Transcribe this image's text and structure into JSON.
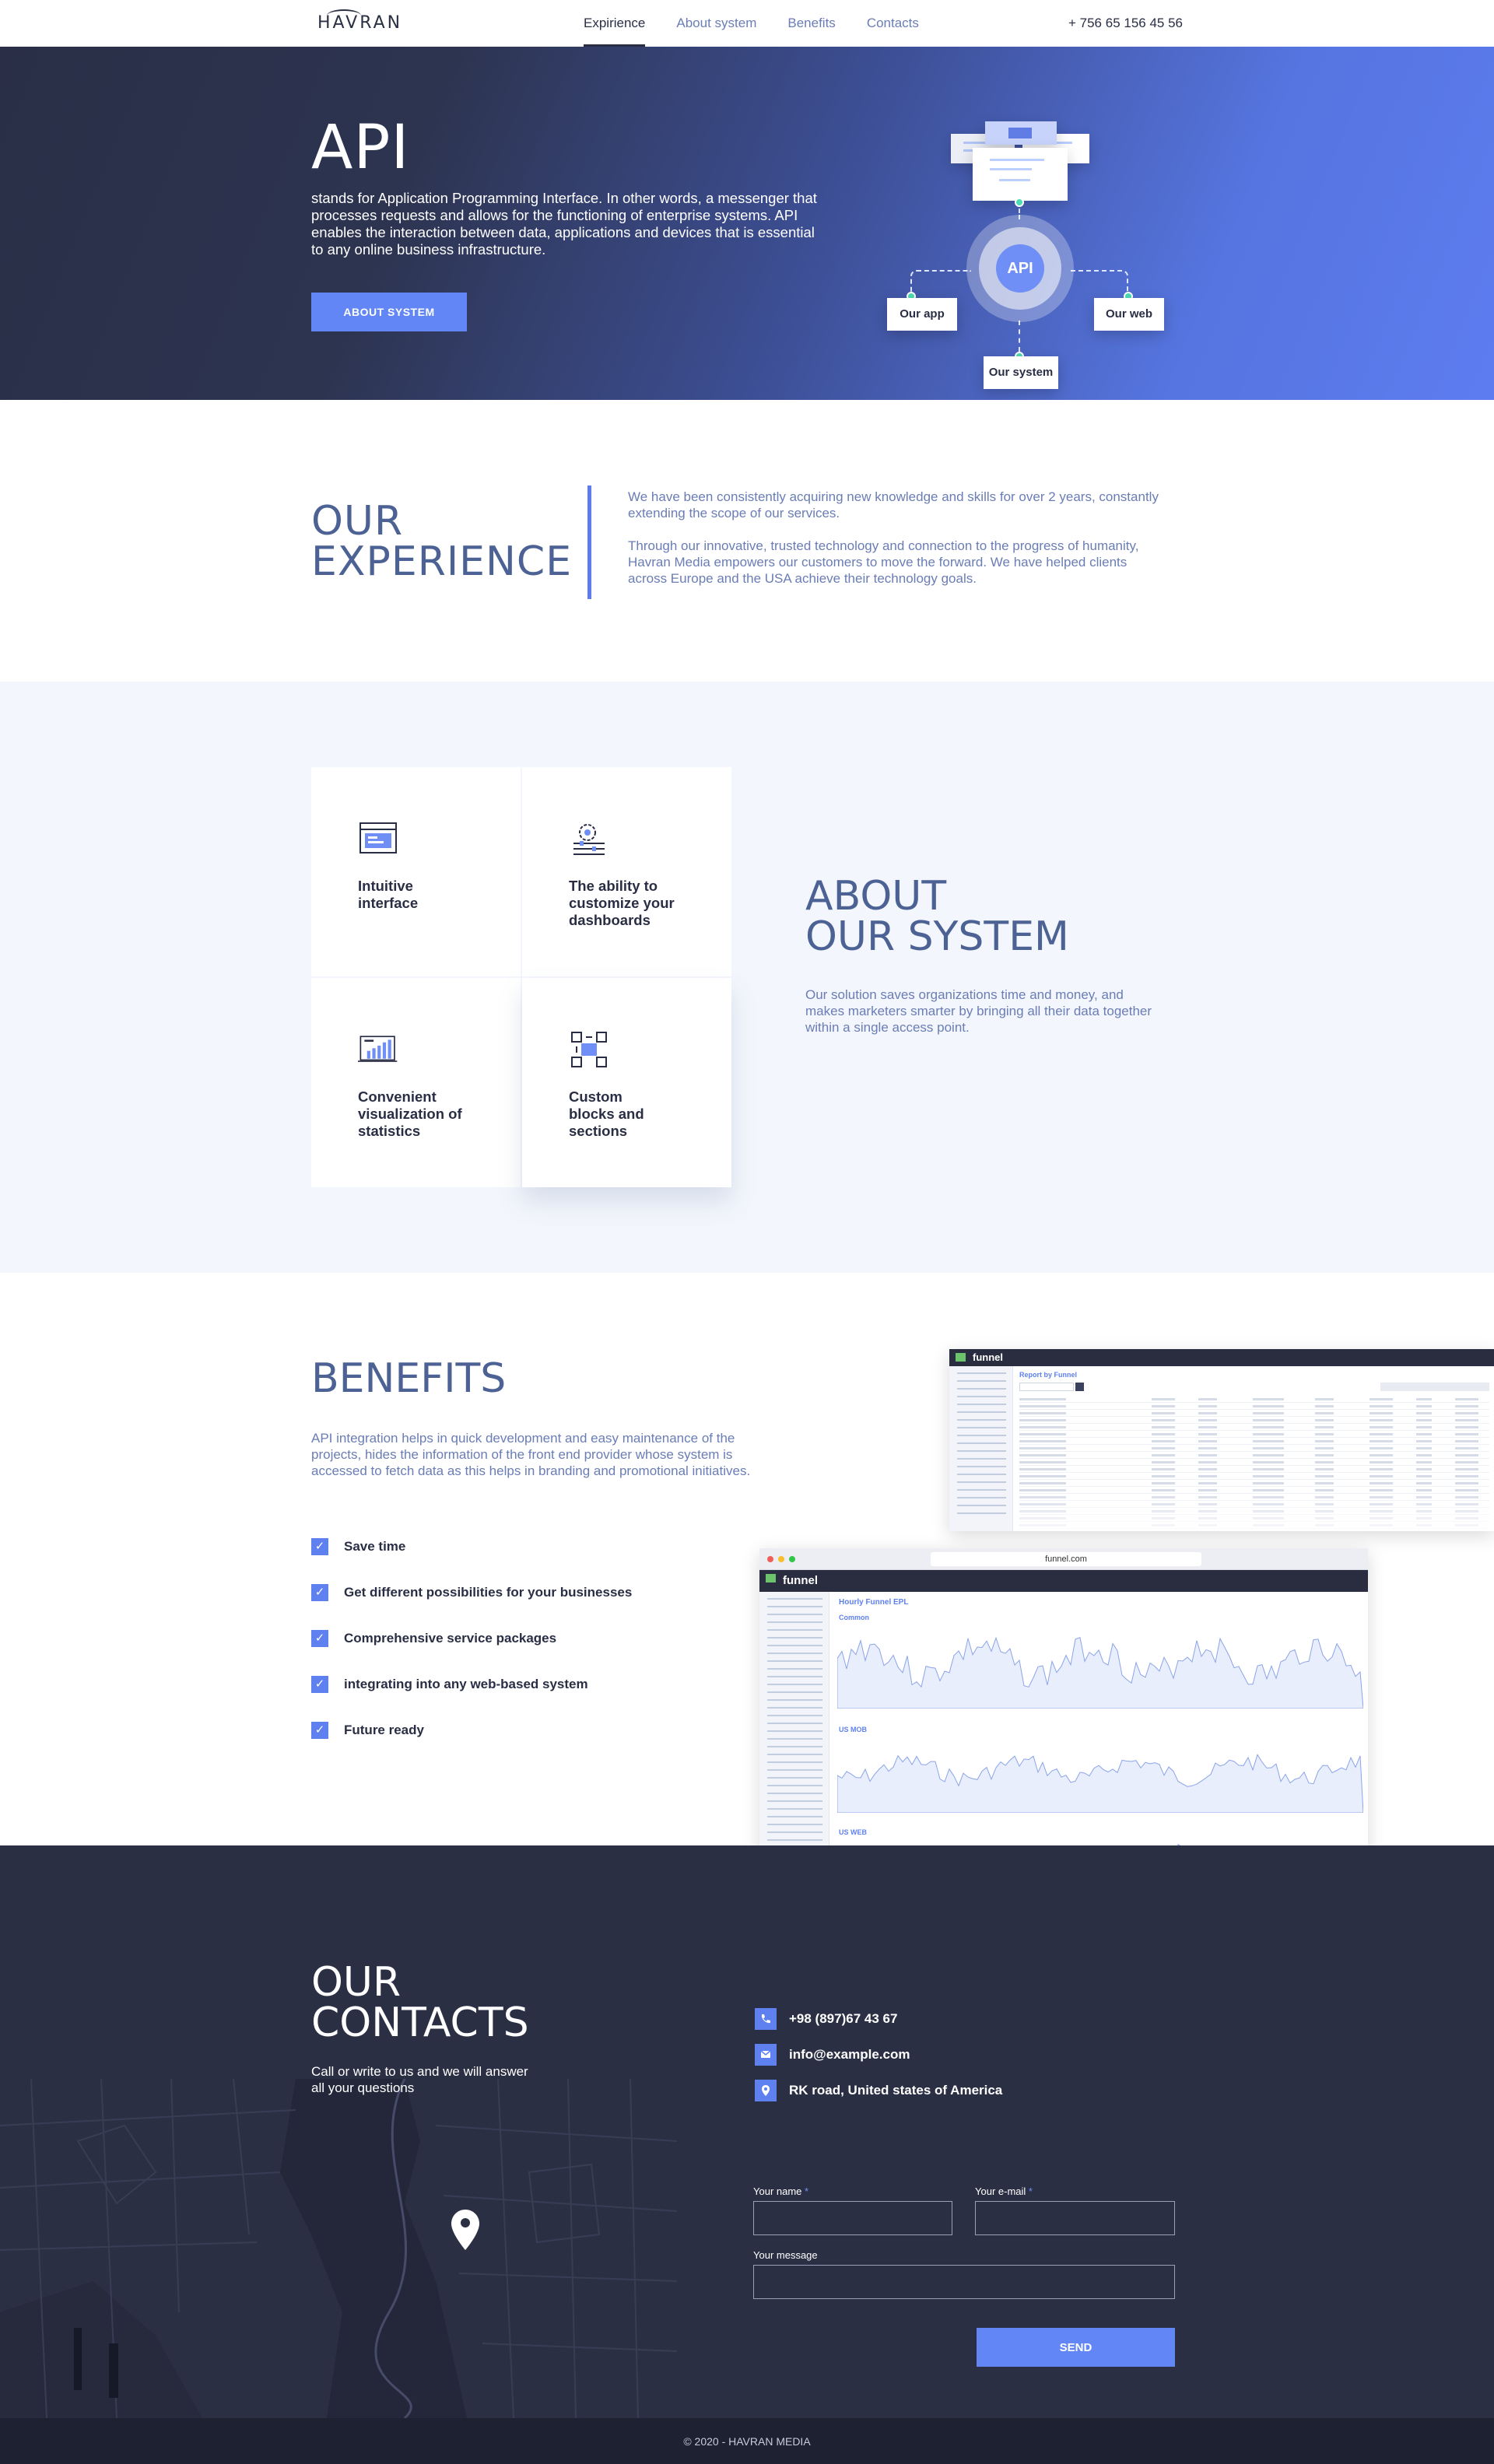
{
  "header": {
    "logo": "HAVRAN",
    "nav": [
      {
        "label": "Expirience",
        "active": true
      },
      {
        "label": "About system",
        "active": false
      },
      {
        "label": "Benefits",
        "active": false
      },
      {
        "label": "Contacts",
        "active": false
      }
    ],
    "phone": "+ 756 65 156 45 56"
  },
  "hero": {
    "title": "API",
    "description": "stands for Application Programming Interface. In other words, a messenger that processes requests and allows for the functioning of enterprise systems. API enables the interaction between data, applications and devices that is essential to any online business infrastructure.",
    "button": "ABOUT SYSTEM",
    "diagram": {
      "center": "API",
      "left": "Our app",
      "right": "Our web",
      "bottom": "Our system"
    }
  },
  "experience": {
    "title_line1": "OUR",
    "title_line2": "EXPERIENCE",
    "paragraph1": "We have been consistently acquiring new knowledge and skills for over 2 years, constantly extending the scope of our services.",
    "paragraph2": "Through our innovative, trusted technology and connection to the progress of humanity, Havran Media empowers our customers to move the forward. We have helped clients across Europe and the USA achieve their technology goals."
  },
  "about": {
    "features": [
      {
        "title": "Intuitive interface",
        "icon": "browser-window-icon"
      },
      {
        "title": "The ability to customize your dashboards",
        "icon": "gear-sliders-icon"
      },
      {
        "title": "Convenient visualization of statistics",
        "icon": "bar-chart-icon"
      },
      {
        "title": "Custom blocks and sections",
        "icon": "blocks-grid-icon"
      }
    ],
    "title_line1": "ABOUT",
    "title_line2": "OUR SYSTEM",
    "text": "Our solution saves organizations time and money, and makes marketers smarter by bringing all their data together within a single access point."
  },
  "benefits": {
    "title": "BENEFITS",
    "text": "API integration helps in quick development and easy maintenance of the projects, hides the information of the front end provider whose system is accessed to fetch data as this helps in branding and promotional initiatives.",
    "items": [
      "Save time",
      "Get different possibilities for your businesses",
      "Comprehensive service packages",
      "integrating into any web-based system",
      "Future ready"
    ],
    "screenshot_back": {
      "brand": "funnel",
      "heading": "Report by Funnel"
    },
    "screenshot_front": {
      "brand": "funnel",
      "url": "funnel.com",
      "heading": "Hourly Funnel EPL",
      "charts": [
        "Common",
        "US MOB",
        "US WEB"
      ]
    }
  },
  "contacts": {
    "title_line1": "OUR",
    "title_line2": "CONTACTS",
    "text": "Call or write to us and we will answer all your questions",
    "phone": "+98 (897)67 43 67",
    "email": "info@example.com",
    "address": "RK road, United states of America",
    "form": {
      "name_label": "Your name",
      "email_label": "Your e-mail",
      "required_mark": "*",
      "message_label": "Your message",
      "name_value": "",
      "email_value": "",
      "message_value": "",
      "send_label": "SEND"
    }
  },
  "footer": {
    "copyright": "© 2020 - HAVRAN MEDIA"
  },
  "colors": {
    "accent": "#6286f5",
    "dark": "#2b2f44",
    "title": "#4d6294",
    "text": "#6a7db5"
  }
}
